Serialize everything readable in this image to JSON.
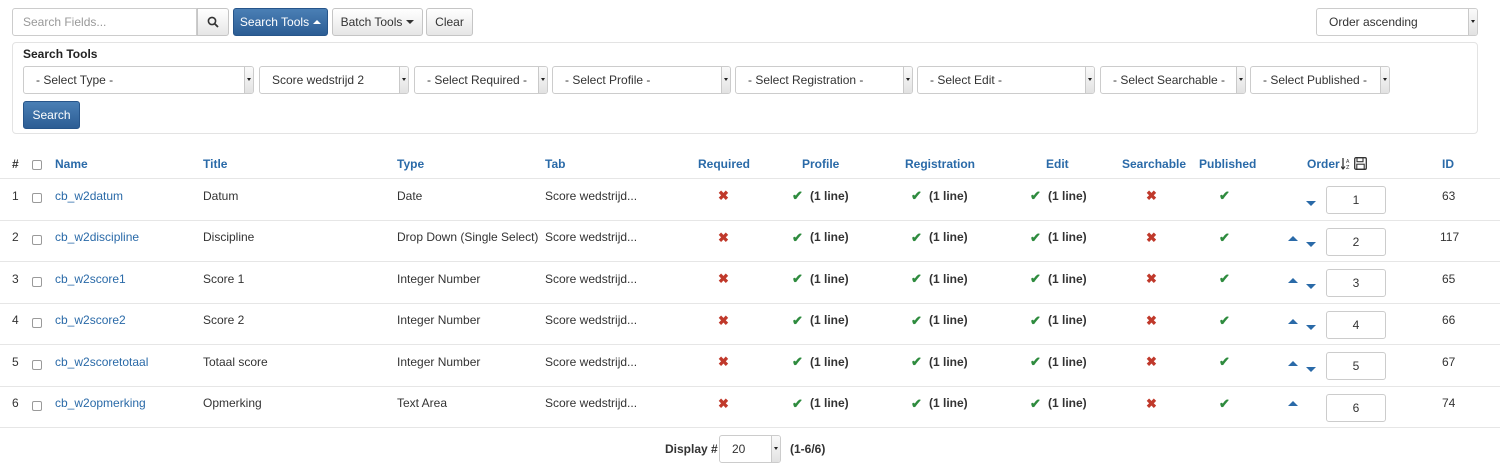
{
  "toolbar": {
    "search_placeholder": "Search Fields...",
    "search_tools_label": "Search Tools",
    "batch_tools_label": "Batch Tools",
    "clear_label": "Clear",
    "order_select": "Order ascending"
  },
  "search_tools": {
    "title": "Search Tools",
    "filters": [
      "- Select Type -",
      "Score wedstrijd 2",
      "- Select Required -",
      "- Select Profile -",
      "- Select Registration -",
      "- Select Edit -",
      "- Select Searchable -",
      "- Select Published -"
    ],
    "search_button": "Search"
  },
  "table": {
    "headers": {
      "num": "#",
      "name": "Name",
      "title": "Title",
      "type": "Type",
      "tab": "Tab",
      "required": "Required",
      "profile": "Profile",
      "registration": "Registration",
      "edit": "Edit",
      "searchable": "Searchable",
      "published": "Published",
      "order": "Order",
      "id": "ID"
    },
    "rows": [
      {
        "num": "1",
        "name": "cb_w2datum",
        "title": "Datum",
        "type": "Date",
        "tab": "Score wedstrijd...",
        "profile": "(1 line)",
        "registration": "(1 line)",
        "edit": "(1 line)",
        "order": "1",
        "id": "63"
      },
      {
        "num": "2",
        "name": "cb_w2discipline",
        "title": "Discipline",
        "type": "Drop Down (Single Select)",
        "tab": "Score wedstrijd...",
        "profile": "(1 line)",
        "registration": "(1 line)",
        "edit": "(1 line)",
        "order": "2",
        "id": "117"
      },
      {
        "num": "3",
        "name": "cb_w2score1",
        "title": "Score 1",
        "type": "Integer Number",
        "tab": "Score wedstrijd...",
        "profile": "(1 line)",
        "registration": "(1 line)",
        "edit": "(1 line)",
        "order": "3",
        "id": "65"
      },
      {
        "num": "4",
        "name": "cb_w2score2",
        "title": "Score 2",
        "type": "Integer Number",
        "tab": "Score wedstrijd...",
        "profile": "(1 line)",
        "registration": "(1 line)",
        "edit": "(1 line)",
        "order": "4",
        "id": "66"
      },
      {
        "num": "5",
        "name": "cb_w2scoretotaal",
        "title": "Totaal score",
        "type": "Integer Number",
        "tab": "Score wedstrijd...",
        "profile": "(1 line)",
        "registration": "(1 line)",
        "edit": "(1 line)",
        "order": "5",
        "id": "67"
      },
      {
        "num": "6",
        "name": "cb_w2opmerking",
        "title": "Opmerking",
        "type": "Text Area",
        "tab": "Score wedstrijd...",
        "profile": "(1 line)",
        "registration": "(1 line)",
        "edit": "(1 line)",
        "order": "6",
        "id": "74"
      }
    ]
  },
  "footer": {
    "display_label": "Display #",
    "display_value": "20",
    "range": "(1-6/6)"
  },
  "colors": {
    "link": "#2a6aa8",
    "primary": "#2c5d94",
    "check": "#2e8b3e",
    "cross": "#c0392b"
  }
}
